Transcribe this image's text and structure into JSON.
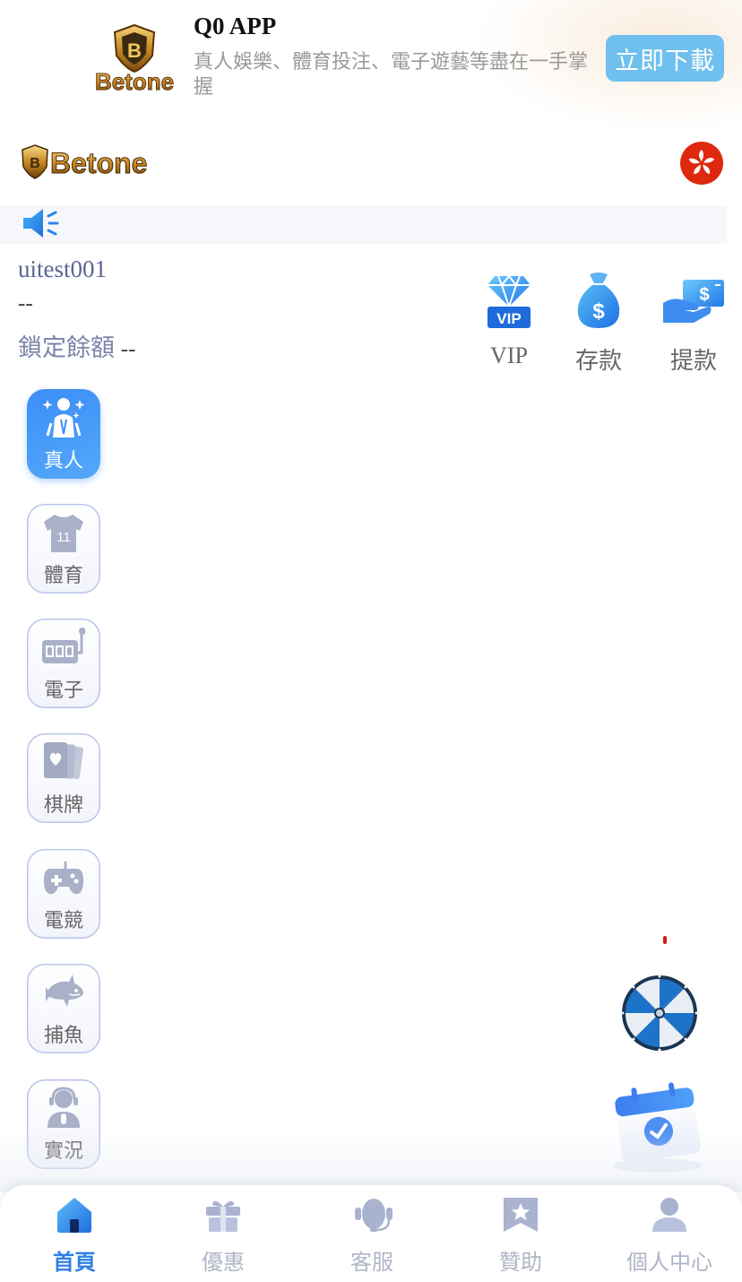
{
  "app_banner": {
    "brand_text": "Betone",
    "title": "Q0 APP",
    "description": "真人娛樂、體育投注、電子遊藝等盡在一手掌握",
    "download_label": "立即下載"
  },
  "header": {
    "logo_text": "Betone",
    "region_flag": "hong-kong-flag-icon"
  },
  "notice": {
    "icon": "speaker-icon",
    "text": ""
  },
  "user": {
    "username": "uitest001",
    "balance": "--",
    "locked_label": "鎖定餘額",
    "locked_value": "--"
  },
  "quick_actions": [
    {
      "id": "vip",
      "label": "VIP",
      "icon": "vip-diamond-icon"
    },
    {
      "id": "deposit",
      "label": "存款",
      "icon": "money-bag-icon"
    },
    {
      "id": "withdraw",
      "label": "提款",
      "icon": "withdraw-card-icon"
    }
  ],
  "game_categories": [
    {
      "label": "真人",
      "icon": "live-dealer-icon",
      "active": true
    },
    {
      "label": "體育",
      "icon": "jersey-icon",
      "active": false
    },
    {
      "label": "電子",
      "icon": "slot-machine-icon",
      "active": false
    },
    {
      "label": "棋牌",
      "icon": "playing-cards-icon",
      "active": false
    },
    {
      "label": "電競",
      "icon": "gamepad-icon",
      "active": false
    },
    {
      "label": "捕魚",
      "icon": "fish-icon",
      "active": false
    },
    {
      "label": "實況",
      "icon": "streamer-icon",
      "active": false
    }
  ],
  "floating": {
    "wheel_icon": "lucky-wheel-icon",
    "calendar_icon": "check-in-calendar-icon"
  },
  "bottom_nav": [
    {
      "label": "首頁",
      "icon": "home-icon",
      "active": true
    },
    {
      "label": "優惠",
      "icon": "gift-icon",
      "active": false
    },
    {
      "label": "客服",
      "icon": "headset-icon",
      "active": false
    },
    {
      "label": "贊助",
      "icon": "sponsor-badge-icon",
      "active": false
    },
    {
      "label": "個人中心",
      "icon": "user-icon",
      "active": false
    }
  ],
  "colors": {
    "accent": "#2f7fe6",
    "download_button": "#6fc0ee",
    "inactive_nav": "#b0b5c6",
    "category_border": "#b8c4ea"
  }
}
